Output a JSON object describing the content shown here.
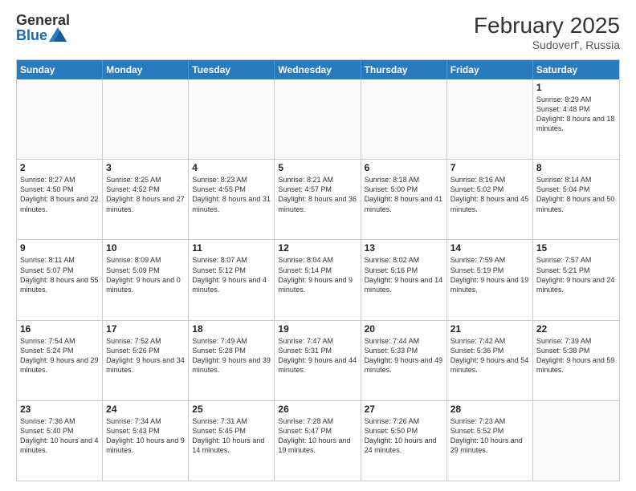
{
  "logo": {
    "general": "General",
    "blue": "Blue",
    "tagline": "GeneralBlue"
  },
  "title": "February 2025",
  "location": "Sudoverf', Russia",
  "header": {
    "days": [
      "Sunday",
      "Monday",
      "Tuesday",
      "Wednesday",
      "Thursday",
      "Friday",
      "Saturday"
    ]
  },
  "rows": [
    [
      {
        "day": "",
        "text": ""
      },
      {
        "day": "",
        "text": ""
      },
      {
        "day": "",
        "text": ""
      },
      {
        "day": "",
        "text": ""
      },
      {
        "day": "",
        "text": ""
      },
      {
        "day": "",
        "text": ""
      },
      {
        "day": "1",
        "text": "Sunrise: 8:29 AM\nSunset: 4:48 PM\nDaylight: 8 hours and 18 minutes."
      }
    ],
    [
      {
        "day": "2",
        "text": "Sunrise: 8:27 AM\nSunset: 4:50 PM\nDaylight: 8 hours and 22 minutes."
      },
      {
        "day": "3",
        "text": "Sunrise: 8:25 AM\nSunset: 4:52 PM\nDaylight: 8 hours and 27 minutes."
      },
      {
        "day": "4",
        "text": "Sunrise: 8:23 AM\nSunset: 4:55 PM\nDaylight: 8 hours and 31 minutes."
      },
      {
        "day": "5",
        "text": "Sunrise: 8:21 AM\nSunset: 4:57 PM\nDaylight: 8 hours and 36 minutes."
      },
      {
        "day": "6",
        "text": "Sunrise: 8:18 AM\nSunset: 5:00 PM\nDaylight: 8 hours and 41 minutes."
      },
      {
        "day": "7",
        "text": "Sunrise: 8:16 AM\nSunset: 5:02 PM\nDaylight: 8 hours and 45 minutes."
      },
      {
        "day": "8",
        "text": "Sunrise: 8:14 AM\nSunset: 5:04 PM\nDaylight: 8 hours and 50 minutes."
      }
    ],
    [
      {
        "day": "9",
        "text": "Sunrise: 8:11 AM\nSunset: 5:07 PM\nDaylight: 8 hours and 55 minutes."
      },
      {
        "day": "10",
        "text": "Sunrise: 8:09 AM\nSunset: 5:09 PM\nDaylight: 9 hours and 0 minutes."
      },
      {
        "day": "11",
        "text": "Sunrise: 8:07 AM\nSunset: 5:12 PM\nDaylight: 9 hours and 4 minutes."
      },
      {
        "day": "12",
        "text": "Sunrise: 8:04 AM\nSunset: 5:14 PM\nDaylight: 9 hours and 9 minutes."
      },
      {
        "day": "13",
        "text": "Sunrise: 8:02 AM\nSunset: 5:16 PM\nDaylight: 9 hours and 14 minutes."
      },
      {
        "day": "14",
        "text": "Sunrise: 7:59 AM\nSunset: 5:19 PM\nDaylight: 9 hours and 19 minutes."
      },
      {
        "day": "15",
        "text": "Sunrise: 7:57 AM\nSunset: 5:21 PM\nDaylight: 9 hours and 24 minutes."
      }
    ],
    [
      {
        "day": "16",
        "text": "Sunrise: 7:54 AM\nSunset: 5:24 PM\nDaylight: 9 hours and 29 minutes."
      },
      {
        "day": "17",
        "text": "Sunrise: 7:52 AM\nSunset: 5:26 PM\nDaylight: 9 hours and 34 minutes."
      },
      {
        "day": "18",
        "text": "Sunrise: 7:49 AM\nSunset: 5:28 PM\nDaylight: 9 hours and 39 minutes."
      },
      {
        "day": "19",
        "text": "Sunrise: 7:47 AM\nSunset: 5:31 PM\nDaylight: 9 hours and 44 minutes."
      },
      {
        "day": "20",
        "text": "Sunrise: 7:44 AM\nSunset: 5:33 PM\nDaylight: 9 hours and 49 minutes."
      },
      {
        "day": "21",
        "text": "Sunrise: 7:42 AM\nSunset: 5:36 PM\nDaylight: 9 hours and 54 minutes."
      },
      {
        "day": "22",
        "text": "Sunrise: 7:39 AM\nSunset: 5:38 PM\nDaylight: 9 hours and 59 minutes."
      }
    ],
    [
      {
        "day": "23",
        "text": "Sunrise: 7:36 AM\nSunset: 5:40 PM\nDaylight: 10 hours and 4 minutes."
      },
      {
        "day": "24",
        "text": "Sunrise: 7:34 AM\nSunset: 5:43 PM\nDaylight: 10 hours and 9 minutes."
      },
      {
        "day": "25",
        "text": "Sunrise: 7:31 AM\nSunset: 5:45 PM\nDaylight: 10 hours and 14 minutes."
      },
      {
        "day": "26",
        "text": "Sunrise: 7:28 AM\nSunset: 5:47 PM\nDaylight: 10 hours and 19 minutes."
      },
      {
        "day": "27",
        "text": "Sunrise: 7:26 AM\nSunset: 5:50 PM\nDaylight: 10 hours and 24 minutes."
      },
      {
        "day": "28",
        "text": "Sunrise: 7:23 AM\nSunset: 5:52 PM\nDaylight: 10 hours and 29 minutes."
      },
      {
        "day": "",
        "text": ""
      }
    ]
  ]
}
